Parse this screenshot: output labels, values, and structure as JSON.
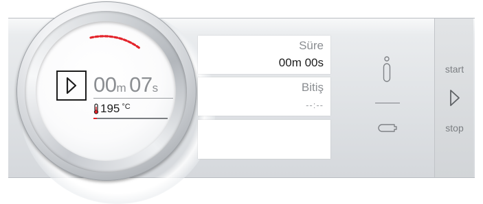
{
  "knob": {
    "timer": {
      "minutes": "00",
      "minutes_unit": "m",
      "seconds": "07",
      "seconds_unit": "s"
    },
    "temperature": {
      "value": "195",
      "unit": "°C"
    },
    "progress_fraction": 0.05,
    "play_icon": "play-outline-icon",
    "thermometer_icon": "thermometer-icon"
  },
  "fields": [
    {
      "label": "Süre",
      "value": "00m 00s"
    },
    {
      "label": "Bitiş",
      "value": "--:--"
    },
    {
      "label": "",
      "value": ""
    }
  ],
  "controls": {
    "info_icon": "info-icon",
    "key_icon": "key-icon"
  },
  "side": {
    "start_label": "start",
    "stop_label": "stop",
    "play_icon": "play-outline-icon"
  },
  "colors": {
    "accent_red": "#e3242b",
    "text_dark": "#1b1b1b",
    "text_grey": "#8a8d91",
    "panel": "#dfe2e5"
  }
}
